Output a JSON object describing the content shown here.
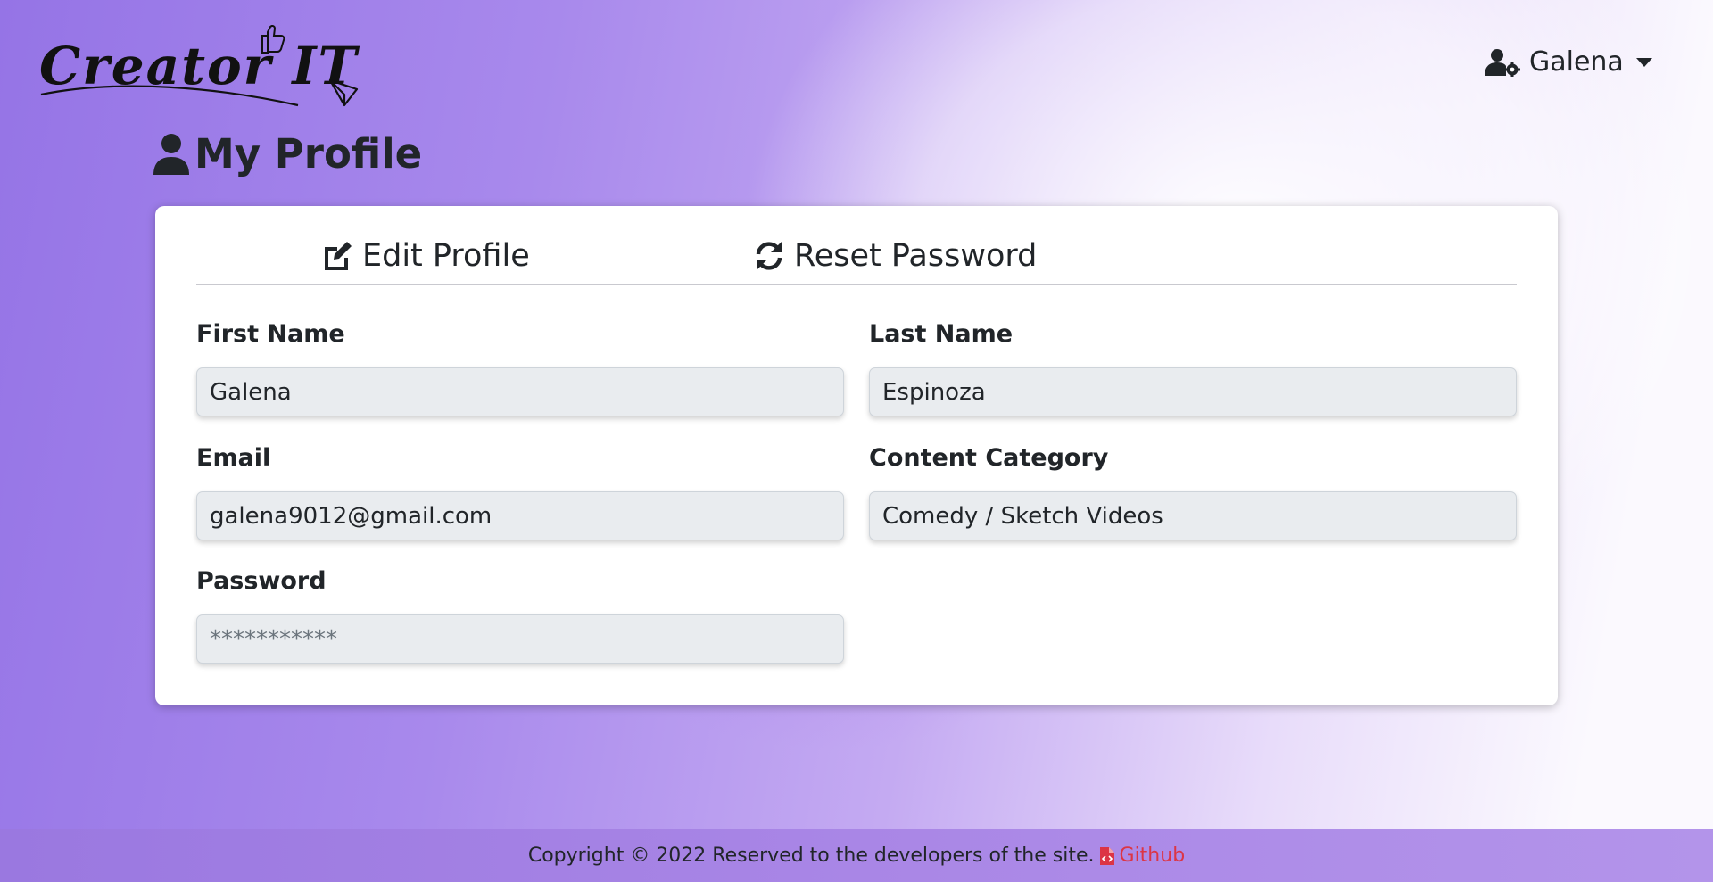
{
  "brand": {
    "logo_text": "Creator IT"
  },
  "header": {
    "user_name": "Galena",
    "user_icon": "user-gear-icon"
  },
  "page": {
    "title": "My Profile",
    "title_icon": "user-icon"
  },
  "tabs": [
    {
      "label": "Edit Profile",
      "icon": "edit-icon"
    },
    {
      "label": "Reset Password",
      "icon": "sync-icon"
    }
  ],
  "form": {
    "first_name": {
      "label": "First Name",
      "value": "Galena"
    },
    "last_name": {
      "label": "Last Name",
      "value": "Espinoza"
    },
    "email": {
      "label": "Email",
      "value": "galena9012@gmail.com"
    },
    "content_category": {
      "label": "Content Category",
      "value": "Comedy / Sketch Videos"
    },
    "password": {
      "label": "Password",
      "placeholder": "***********"
    }
  },
  "footer": {
    "copyright": "Copyright © 2022 Reserved to the developers of the site.",
    "link_label": "Github",
    "link_icon": "file-code-icon"
  },
  "colors": {
    "link": "#dc3545",
    "text": "#212529",
    "input_bg": "#e9ecef"
  }
}
